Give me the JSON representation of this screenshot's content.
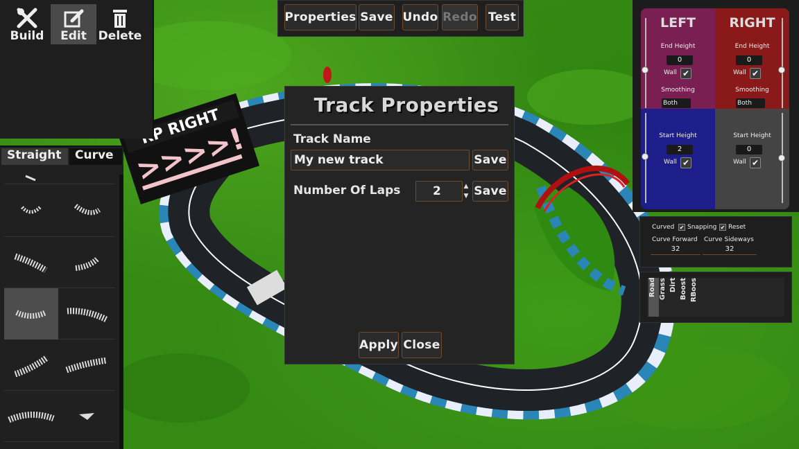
{
  "tools": {
    "build": "Build",
    "edit": "Edit",
    "delete": "Delete",
    "active": "edit"
  },
  "palette": {
    "tabs": [
      "Straight",
      "Curve"
    ],
    "active_tab": "Curve",
    "selected_piece_index": 6
  },
  "toolbar": {
    "properties": "Properties",
    "save": "Save",
    "undo": "Undo",
    "redo": "Redo",
    "test": "Test"
  },
  "scene": {
    "banner_text": "RP RIGHT"
  },
  "dialog": {
    "title": "Track Properties",
    "track_name_label": "Track Name",
    "track_name_value": "My new track",
    "track_name_save": "Save",
    "laps_label": "Number Of Laps",
    "laps_value": "2",
    "laps_save": "Save",
    "apply": "Apply",
    "close": "Close"
  },
  "heights": {
    "left_title": "LEFT",
    "right_title": "RIGHT",
    "end_height_label": "End Height",
    "start_height_label": "Start Height",
    "wall_label": "Wall",
    "smoothing_label": "Smoothing",
    "left_end_height": "0",
    "right_end_height": "0",
    "left_start_height": "2",
    "right_start_height": "0",
    "left_smoothing": "Both",
    "right_smoothing": "Both",
    "colors": {
      "left_top": "#7a1f52",
      "right_top": "#8a1a1a",
      "left_bottom": "#1e1e8a",
      "right_bottom": "#444444"
    }
  },
  "curve": {
    "curved_label": "Curved",
    "snapping_label": "Snapping",
    "reset_label": "Reset",
    "forward_label": "Curve Forward",
    "sideways_label": "Curve Sideways",
    "forward_value": "32",
    "sideways_value": "32"
  },
  "surfaces": {
    "items": [
      "Road",
      "Grass",
      "Dirt",
      "Boost",
      "RBoos"
    ],
    "active": "Road"
  }
}
